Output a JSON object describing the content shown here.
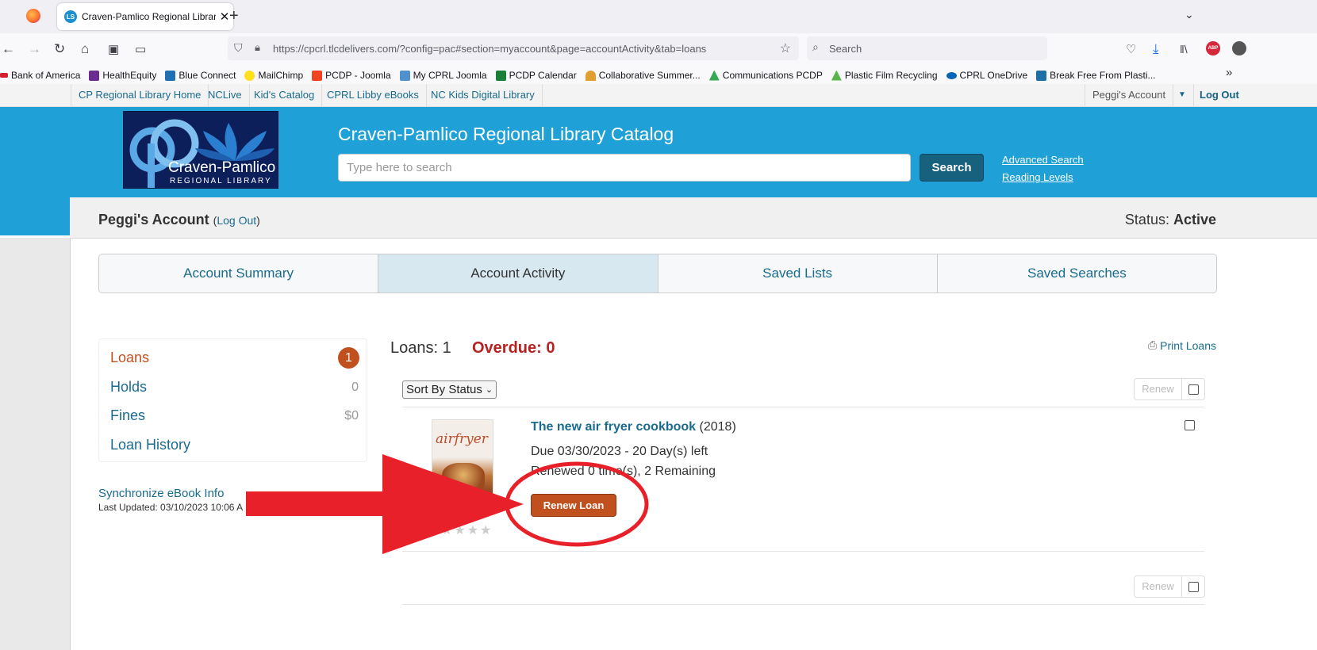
{
  "browser": {
    "tab_title": "Craven-Pamlico Regional Librar",
    "url": "https://cpcrl.tlcdelivers.com/?config=pac#section=myaccount&page=accountActivity&tab=loans",
    "search_placeholder": "Search",
    "bookmarks": [
      {
        "label": "Bank of America",
        "color": "#d31e2d"
      },
      {
        "label": "HealthEquity",
        "color": "#6a2c91"
      },
      {
        "label": "Blue Connect",
        "color": "#1f6fb5"
      },
      {
        "label": "MailChimp",
        "color": "#ffe01b"
      },
      {
        "label": "PCDP - Joomla",
        "color": "#f44321"
      },
      {
        "label": "My CPRL Joomla",
        "color": "#5091cd"
      },
      {
        "label": "PCDP Calendar",
        "color": "#188038"
      },
      {
        "label": "Collaborative Summer...",
        "color": "#e0a030"
      },
      {
        "label": "Communications PCDP",
        "color": "#34a853"
      },
      {
        "label": "Plastic Film Recycling",
        "color": "#5ab54b"
      },
      {
        "label": "CPRL OneDrive",
        "color": "#0364b8"
      },
      {
        "label": "Break Free From Plasti...",
        "color": "#1d6fa5"
      }
    ]
  },
  "site": {
    "top_links": [
      "CP Regional Library Home",
      "NCLive",
      "Kid's Catalog",
      "CPRL Libby eBooks",
      "NC Kids Digital Library"
    ],
    "account_link": "Peggi's Account",
    "logout": "Log Out",
    "logo_text": "Craven-Pamlico",
    "logo_subtext": "REGIONAL LIBRARY",
    "catalog_title": "Craven-Pamlico Regional Library Catalog",
    "search_placeholder": "Type here to search",
    "search_button": "Search",
    "advanced_search": "Advanced Search",
    "reading_levels": "Reading Levels"
  },
  "account": {
    "name": "Peggi's Account",
    "logout_label": "Log Out",
    "status_label": "Status:",
    "status_value": "Active",
    "tabs": [
      "Account Summary",
      "Account Activity",
      "Saved Lists",
      "Saved Searches"
    ],
    "sidebar": {
      "loans": {
        "label": "Loans",
        "count": "1"
      },
      "holds": {
        "label": "Holds",
        "count": "0"
      },
      "fines": {
        "label": "Fines",
        "count": "$0"
      },
      "history": {
        "label": "Loan History"
      }
    },
    "sync_label": "Synchronize eBook Info",
    "last_updated": "Last Updated: 03/10/2023 10:06 A"
  },
  "loans": {
    "loans_label": "Loans: 1",
    "overdue_label": "Overdue: 0",
    "print_label": "Print Loans",
    "sort_label": "Sort By Status",
    "renew_label": "Renew",
    "item": {
      "title": "The new air fryer cookbook",
      "year": "(2018)",
      "due": "Due 03/30/2023 - 20 Day(s) left",
      "renewed": "Renewed 0 time(s), 2 Remaining",
      "renew_button": "Renew Loan",
      "cover_text": "airfryer"
    }
  }
}
